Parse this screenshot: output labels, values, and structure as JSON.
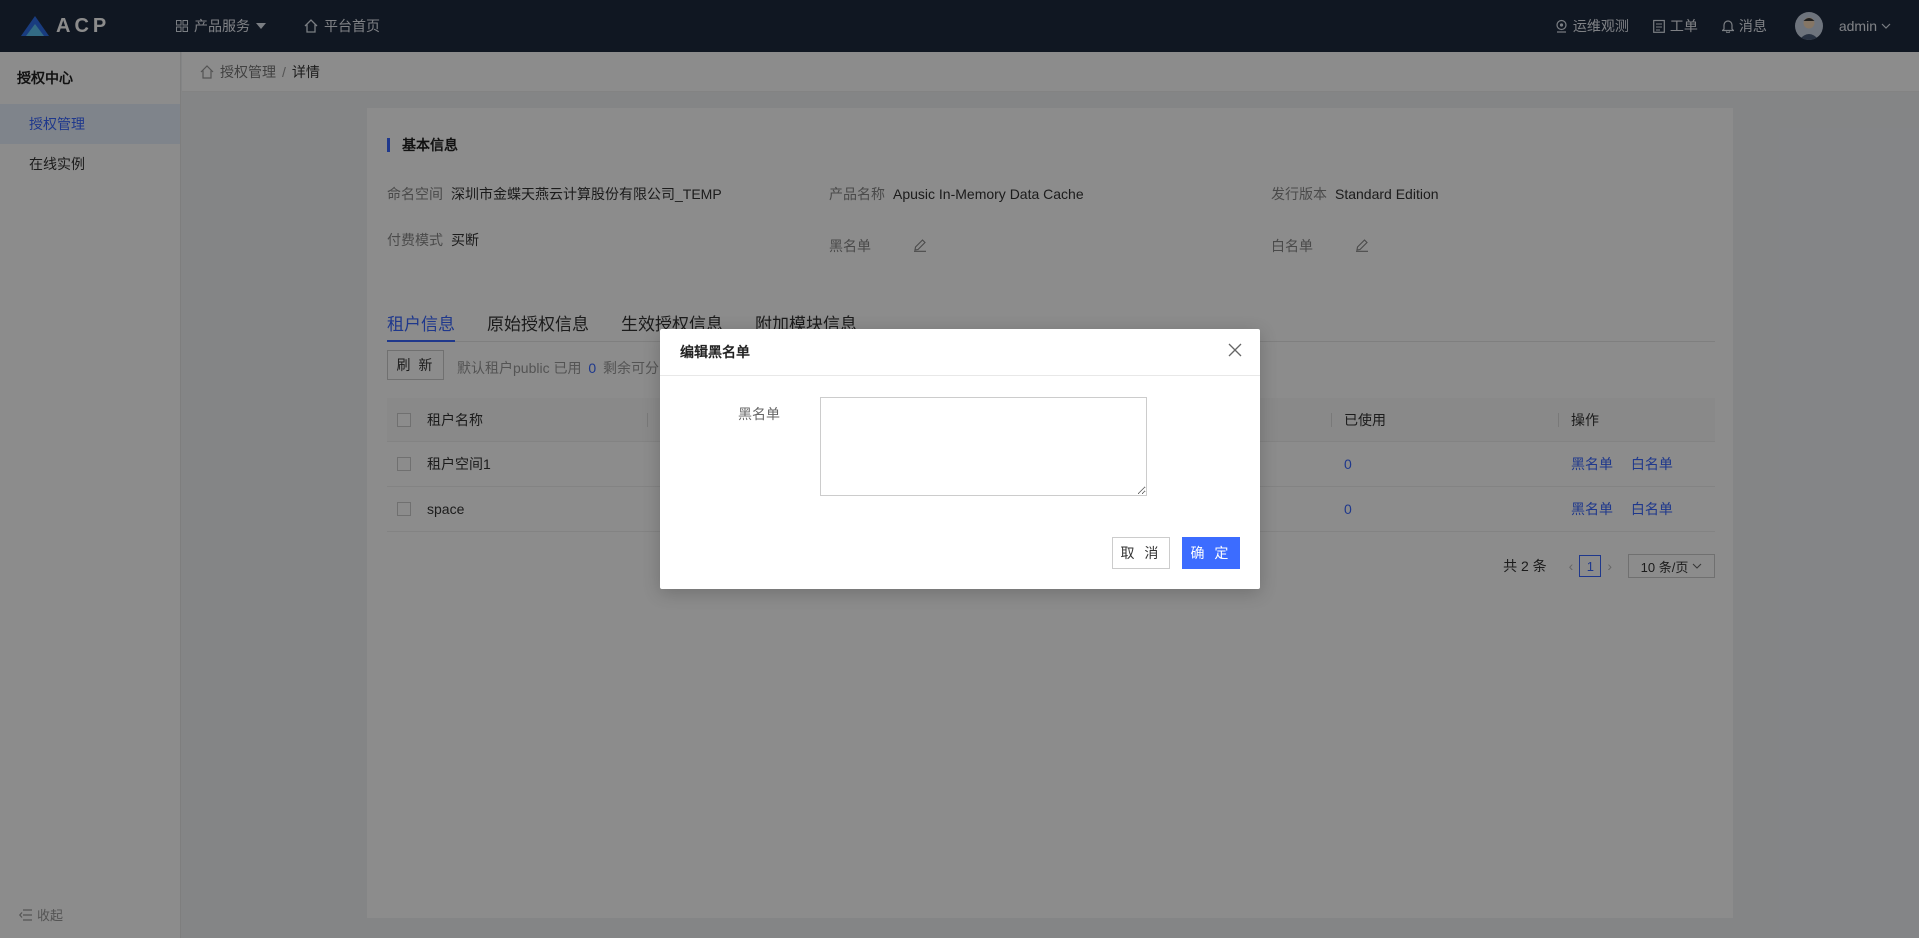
{
  "app": {
    "logo_text": "ACP"
  },
  "topnav": {
    "products_label": "产品服务",
    "home_label": "平台首页"
  },
  "topright": {
    "ops_label": "运维观测",
    "ticket_label": "工单",
    "message_label": "消息",
    "user_label": "admin"
  },
  "sidebar": {
    "title": "授权中心",
    "items": [
      {
        "label": "授权管理"
      },
      {
        "label": "在线实例"
      }
    ],
    "collapse_label": "收起"
  },
  "breadcrumb": {
    "parent": "授权管理",
    "separator": "/",
    "current": "详情"
  },
  "basic_info": {
    "title": "基本信息",
    "namespace_label": "命名空间",
    "namespace_value": "深圳市金蝶天燕云计算股份有限公司_TEMP",
    "product_label": "产品名称",
    "product_value": "Apusic In-Memory Data Cache",
    "edition_label": "发行版本",
    "edition_value": "Standard Edition",
    "pay_label": "付费模式",
    "pay_value": "买断",
    "blacklist_label": "黑名单",
    "whitelist_label": "白名单"
  },
  "tabs": [
    {
      "label": "租户信息"
    },
    {
      "label": "原始授权信息"
    },
    {
      "label": "生效授权信息"
    },
    {
      "label": "附加模块信息"
    }
  ],
  "toolbar": {
    "refresh_label": "刷 新",
    "quota_prefix": "默认租户public 已用",
    "quota_used": "0",
    "quota_suffix": "剩余可分"
  },
  "table": {
    "headers": {
      "name": "租户名称",
      "used": "已使用",
      "ops": "操作"
    },
    "rows": [
      {
        "name": "租户空间1",
        "used": "0",
        "op_black": "黑名单",
        "op_white": "白名单"
      },
      {
        "name": "space",
        "used": "0",
        "op_black": "黑名单",
        "op_white": "白名单"
      }
    ]
  },
  "pager": {
    "total": "共 2 条",
    "current_page": "1",
    "page_size": "10 条/页"
  },
  "modal": {
    "title": "编辑黑名单",
    "field_label": "黑名单",
    "field_value": "",
    "cancel_label": "取 消",
    "ok_label": "确 定"
  },
  "colors": {
    "accent": "#3967ff",
    "topbar": "#1e2a3f"
  }
}
